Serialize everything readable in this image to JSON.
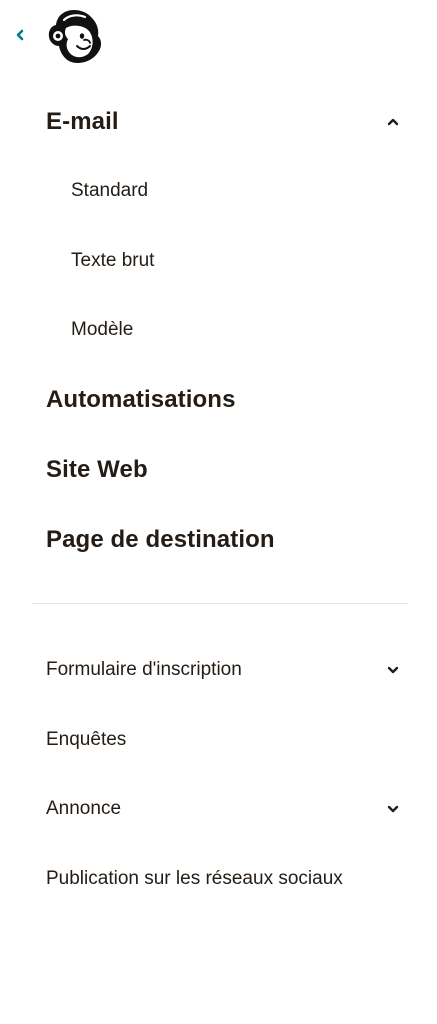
{
  "header": {
    "back_icon": "chevron-left-icon",
    "logo_icon": "mailchimp-freddie-logo",
    "accent_color": "#007c89"
  },
  "primary_nav": {
    "email": {
      "label": "E-mail",
      "expanded": true,
      "items": [
        {
          "label": "Standard"
        },
        {
          "label": "Texte brut"
        },
        {
          "label": "Modèle"
        }
      ]
    },
    "automations": {
      "label": "Automatisations"
    },
    "website": {
      "label": "Site Web"
    },
    "landing_page": {
      "label": "Page de destination"
    }
  },
  "secondary_nav": {
    "signup_form": {
      "label": "Formulaire d'inscription",
      "expanded": false
    },
    "surveys": {
      "label": "Enquêtes"
    },
    "ad": {
      "label": "Annonce",
      "expanded": false
    },
    "social_post": {
      "label": "Publication sur les réseaux sociaux"
    }
  }
}
